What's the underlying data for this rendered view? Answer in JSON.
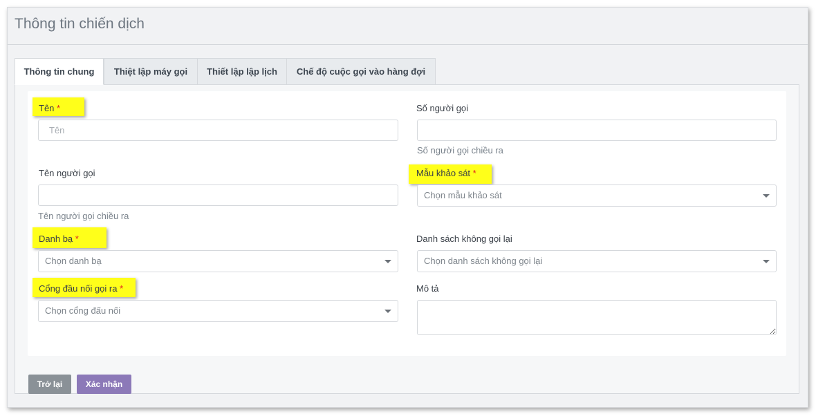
{
  "header": {
    "title": "Thông tin chiến dịch"
  },
  "tabs": [
    {
      "label": "Thông tin chung"
    },
    {
      "label": "Thiệt lập máy gọi"
    },
    {
      "label": "Thiết lập lập lịch"
    },
    {
      "label": "Chế độ cuộc gọi vào hàng đợi"
    }
  ],
  "form": {
    "required_mark": "*",
    "name": {
      "label": "Tên",
      "placeholder": "Tên"
    },
    "caller_number": {
      "label": "Số người gọi",
      "help": "Số người gọi chiều ra"
    },
    "caller_name": {
      "label": "Tên người gọi",
      "help": "Tên người gọi chiều ra"
    },
    "survey_template": {
      "label": "Mẫu khảo sát",
      "placeholder": "Chọn mẫu khảo sát"
    },
    "contacts": {
      "label": "Danh bạ",
      "placeholder": "Chọn danh bạ"
    },
    "no_call_list": {
      "label": "Danh sách không gọi lại",
      "placeholder": "Chọn danh sách không gọi lại"
    },
    "outbound_gateway": {
      "label": "Cổng đầu nối gọi ra",
      "placeholder": "Chọn cổng đấu nối"
    },
    "description": {
      "label": "Mô tả"
    }
  },
  "actions": {
    "back_label": "Trở lại",
    "confirm_label": "Xác nhận"
  },
  "colors": {
    "highlight": "#ffff1a",
    "required": "#e02020",
    "confirm": "#8c79b8",
    "back": "#8a9197"
  }
}
